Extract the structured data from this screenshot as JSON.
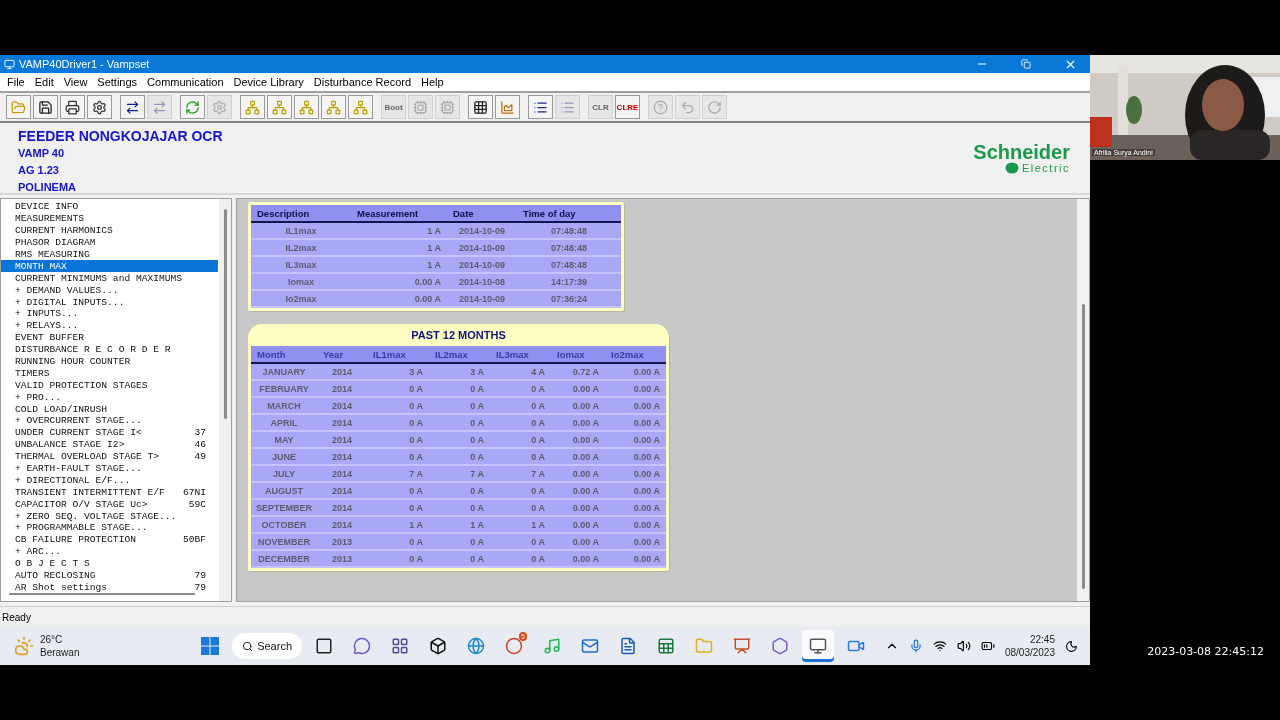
{
  "window": {
    "title": "VAMP40Driver1 - Vampset"
  },
  "menu": [
    "File",
    "Edit",
    "View",
    "Settings",
    "Communication",
    "Device Library",
    "Disturbance Record",
    "Help"
  ],
  "toolbar": [
    [
      {
        "kind": "open",
        "disabled": false
      },
      {
        "kind": "save",
        "disabled": false
      },
      {
        "kind": "print",
        "disabled": false
      },
      {
        "kind": "setup",
        "disabled": false
      }
    ],
    [
      {
        "kind": "transfer",
        "disabled": false
      },
      {
        "kind": "transfer",
        "disabled": true
      }
    ],
    [
      {
        "kind": "refresh",
        "disabled": false
      },
      {
        "kind": "gear",
        "disabled": true
      }
    ],
    [
      {
        "kind": "link",
        "disabled": false
      },
      {
        "kind": "link",
        "disabled": false
      },
      {
        "kind": "link",
        "disabled": false
      },
      {
        "kind": "link",
        "disabled": false
      },
      {
        "kind": "link",
        "disabled": false
      }
    ],
    [
      {
        "kind": "text",
        "label": "Boot",
        "disabled": true
      },
      {
        "kind": "chip",
        "disabled": true
      },
      {
        "kind": "chip",
        "disabled": true
      }
    ],
    [
      {
        "kind": "grid",
        "disabled": false
      },
      {
        "kind": "chart",
        "disabled": false
      }
    ],
    [
      {
        "kind": "list",
        "disabled": false
      },
      {
        "kind": "list",
        "disabled": true
      }
    ],
    [
      {
        "kind": "text",
        "label": "CLR",
        "disabled": true
      },
      {
        "kind": "text",
        "label": "CLRE",
        "disabled": false
      }
    ],
    [
      {
        "kind": "help",
        "disabled": true
      },
      {
        "kind": "undo",
        "disabled": true
      },
      {
        "kind": "reload",
        "disabled": true
      }
    ]
  ],
  "header": {
    "title": "FEEDER NONGKOJAJAR OCR",
    "lines": [
      "VAMP 40",
      "AG 1.23",
      "POLINEMA"
    ],
    "logo": {
      "name": "Schneider",
      "tagline": "Electric"
    }
  },
  "tree": {
    "items": [
      {
        "label": "DEVICE INFO",
        "selected": false
      },
      {
        "label": "MEASUREMENTS",
        "selected": false
      },
      {
        "label": "CURRENT HARMONICS",
        "selected": false
      },
      {
        "label": "PHASOR DIAGRAM",
        "selected": false
      },
      {
        "label": "RMS MEASURING",
        "selected": false
      },
      {
        "label": "MONTH MAX",
        "selected": true
      },
      {
        "label": "CURRENT MINIMUMS and MAXIMUMS",
        "selected": false
      },
      {
        "label": "+ DEMAND VALUES...",
        "selected": false
      },
      {
        "label": "+ DIGITAL INPUTS...",
        "selected": false
      },
      {
        "label": "+ INPUTS...",
        "selected": false
      },
      {
        "label": "+ RELAYS...",
        "selected": false
      },
      {
        "label": "EVENT BUFFER",
        "selected": false
      },
      {
        "label": "DISTURBANCE R E C O R D E R",
        "selected": false
      },
      {
        "label": "RUNNING HOUR COUNTER",
        "selected": false
      },
      {
        "label": "TIMERS",
        "selected": false
      },
      {
        "label": "VALID PROTECTION STAGES",
        "selected": false
      },
      {
        "label": "+ PRO...",
        "selected": false
      },
      {
        "label": "COLD LOAD/INRUSH",
        "selected": false
      },
      {
        "label": "+ OVERCURRENT STAGE...",
        "selected": false
      },
      {
        "label": "UNDER CURRENT STAGE I<",
        "code": "37",
        "selected": false
      },
      {
        "label": "UNBALANCE STAGE I2>",
        "code": "46",
        "selected": false
      },
      {
        "label": "THERMAL OVERLOAD STAGE T>",
        "code": "49",
        "selected": false
      },
      {
        "label": "+ EARTH-FAULT STAGE...",
        "selected": false
      },
      {
        "label": "+ DIRECTIONAL E/F...",
        "selected": false
      },
      {
        "label": "TRANSIENT INTERMITTENT E/F",
        "code": "67NI",
        "selected": false
      },
      {
        "label": "CAPACITOR O/V STAGE Uc>",
        "code": "59C",
        "selected": false
      },
      {
        "label": "+ ZERO SEQ. VOLTAGE STAGE...",
        "selected": false
      },
      {
        "label": "+ PROGRAMMABLE STAGE...",
        "selected": false
      },
      {
        "label": "CB FAILURE PROTECTION",
        "code": "50BF",
        "selected": false
      },
      {
        "label": "+ ARC...",
        "selected": false
      },
      {
        "label": "O B J E C T S",
        "selected": false
      },
      {
        "label": "AUTO RECLOSING",
        "code": "79",
        "selected": false
      },
      {
        "label": "AR Shot settings",
        "code": "79",
        "selected": false
      }
    ]
  },
  "current_max": {
    "columns": [
      "Description",
      "Measurement",
      "Date",
      "Time of day"
    ],
    "rows": [
      [
        "IL1max",
        "1 A",
        "2014-10-09",
        "07:48:48"
      ],
      [
        "IL2max",
        "1 A",
        "2014-10-09",
        "07:48:48"
      ],
      [
        "IL3max",
        "1 A",
        "2014-10-09",
        "07:48:48"
      ],
      [
        "Iomax",
        "0.00 A",
        "2014-10-08",
        "14:17:39"
      ],
      [
        "Io2max",
        "0.00 A",
        "2014-10-09",
        "07:36:24"
      ]
    ]
  },
  "past_months": {
    "title": "PAST 12 MONTHS",
    "columns": [
      "Month",
      "Year",
      "IL1max",
      "IL2max",
      "IL3max",
      "Iomax",
      "Io2max"
    ],
    "rows": [
      [
        "JANUARY",
        "2014",
        "3 A",
        "3 A",
        "4 A",
        "0.72 A",
        "0.00 A"
      ],
      [
        "FEBRUARY",
        "2014",
        "0 A",
        "0 A",
        "0 A",
        "0.00 A",
        "0.00 A"
      ],
      [
        "MARCH",
        "2014",
        "0 A",
        "0 A",
        "0 A",
        "0.00 A",
        "0.00 A"
      ],
      [
        "APRIL",
        "2014",
        "0 A",
        "0 A",
        "0 A",
        "0.00 A",
        "0.00 A"
      ],
      [
        "MAY",
        "2014",
        "0 A",
        "0 A",
        "0 A",
        "0.00 A",
        "0.00 A"
      ],
      [
        "JUNE",
        "2014",
        "0 A",
        "0 A",
        "0 A",
        "0.00 A",
        "0.00 A"
      ],
      [
        "JULY",
        "2014",
        "7 A",
        "7 A",
        "7 A",
        "0.00 A",
        "0.00 A"
      ],
      [
        "AUGUST",
        "2014",
        "0 A",
        "0 A",
        "0 A",
        "0.00 A",
        "0.00 A"
      ],
      [
        "SEPTEMBER",
        "2014",
        "0 A",
        "0 A",
        "0 A",
        "0.00 A",
        "0.00 A"
      ],
      [
        "OCTOBER",
        "2014",
        "1 A",
        "1 A",
        "1 A",
        "0.00 A",
        "0.00 A"
      ],
      [
        "NOVEMBER",
        "2013",
        "0 A",
        "0 A",
        "0 A",
        "0.00 A",
        "0.00 A"
      ],
      [
        "DECEMBER",
        "2013",
        "0 A",
        "0 A",
        "0 A",
        "0.00 A",
        "0.00 A"
      ]
    ]
  },
  "status_bar": "Ready",
  "taskbar": {
    "weather": {
      "temperature": "26°C",
      "condition": "Berawan"
    },
    "search": "Search",
    "badge": "5",
    "apps": [
      {
        "kind": "taskview",
        "selected": false
      },
      {
        "kind": "chat",
        "selected": false
      },
      {
        "kind": "grid",
        "selected": false
      },
      {
        "kind": "box",
        "selected": false
      },
      {
        "kind": "globe",
        "selected": false
      },
      {
        "kind": "browser",
        "selected": false
      },
      {
        "kind": "music",
        "selected": false
      },
      {
        "kind": "mail",
        "selected": false
      },
      {
        "kind": "word",
        "selected": false
      },
      {
        "kind": "sheet",
        "selected": false
      },
      {
        "kind": "folder",
        "selected": false
      },
      {
        "kind": "slides",
        "selected": false
      },
      {
        "kind": "hexagon",
        "selected": false
      },
      {
        "kind": "monitor",
        "selected": true
      },
      {
        "kind": "video",
        "selected": false
      }
    ],
    "time": "22:45",
    "date": "08/03/2023"
  },
  "video": {
    "kind": "picture",
    "name": "Afrilia Surya Andini"
  },
  "timestamp": "2023-03-08 22:45:12"
}
